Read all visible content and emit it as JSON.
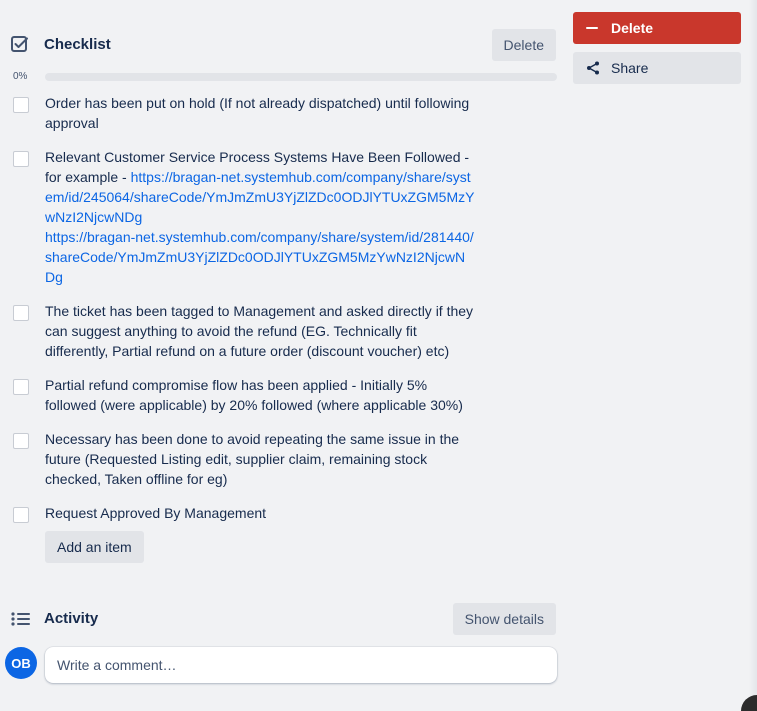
{
  "checklist": {
    "title": "Checklist",
    "delete_label": "Delete",
    "progress_label": "0%",
    "progress": 0,
    "items": [
      {
        "checked": false,
        "text": "Order has been put on hold (If not already dispatched) until following approval"
      },
      {
        "checked": false,
        "text_prefix": "Relevant Customer Service Process Systems Have Been Followed - for example - ",
        "link1": "https://bragan-net.systemhub.com/company/share/system/id/245064/shareCode/YmJmZmU3YjZlZDc0ODJlYTUxZGM5MzYwNzI2NjcwNDg",
        "link2": "https://bragan-net.systemhub.com/company/share/system/id/281440/shareCode/YmJmZmU3YjZlZDc0ODJlYTUxZGM5MzYwNzI2NjcwNDg"
      },
      {
        "checked": false,
        "text": "The ticket has been tagged to Management and asked directly if they can suggest anything to avoid the refund (EG. Technically fit differently, Partial refund on a future order (discount voucher) etc)"
      },
      {
        "checked": false,
        "text": "Partial refund compromise flow has been applied - Initially 5% followed (were applicable) by 20% followed (where applicable 30%)"
      },
      {
        "checked": false,
        "text": "Necessary has been done to avoid repeating the same issue in the future (Requested Listing edit, supplier claim, remaining stock checked, Taken offline for eg)"
      },
      {
        "checked": false,
        "text": "Request Approved By Management"
      }
    ],
    "add_item_label": "Add an item"
  },
  "activity": {
    "title": "Activity",
    "show_details_label": "Show details",
    "avatar_initials": "OB",
    "comment_placeholder": "Write a comment…"
  },
  "sidebar": {
    "delete_label": "Delete",
    "share_label": "Share"
  },
  "colors": {
    "background": "#f1f2f4",
    "danger": "#c9372c",
    "link": "#0c66e4",
    "avatar": "#0c66e4",
    "button_gray": "#e2e4e8"
  },
  "icons": {
    "checklist": "checkbox-checked-icon",
    "activity": "list-icon",
    "delete": "minus-icon",
    "share": "share-icon"
  }
}
